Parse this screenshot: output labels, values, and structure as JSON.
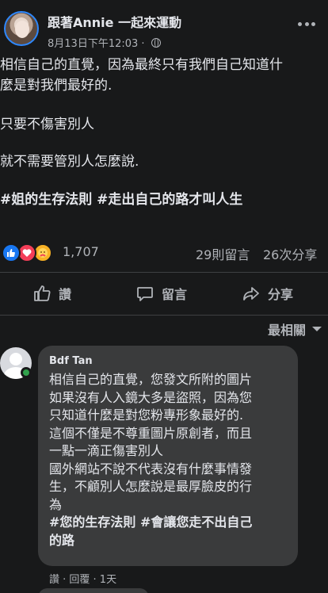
{
  "post": {
    "author": "跟著Annie 一起來運動",
    "timestamp": "8月13日下午12:03 ·",
    "privacy_icon": "globe-icon",
    "body": {
      "line1": "相信自己的直覺，因為最終只有我們自己知道什",
      "line2": "麼是對我們最好的.",
      "line3": "只要不傷害別人",
      "line4": "就不需要管別人怎麼說.",
      "hashtags": "#姐的生存法則 #走出自己的路才叫人生"
    }
  },
  "reactions": {
    "icons": [
      "like-icon",
      "love-icon",
      "care-icon"
    ],
    "count": "1,707",
    "comments": "29則留言",
    "shares": "26次分享"
  },
  "actions": {
    "like": "讚",
    "comment": "留言",
    "share": "分享"
  },
  "sort": {
    "label": "最相關"
  },
  "comment": {
    "name": "Bdf Tan",
    "lines": [
      "相信自己的直覺，您發文所附的圖片",
      "如果沒有人入鏡大多是盜照，因為您",
      "只知道什麼是對您粉專形象最好的.",
      "這個不僅是不尊重圖片原創者，而且",
      "一點一滴正傷害別人",
      "國外網站不說不代表沒有什麼事情發",
      "生，不顧別人怎麼說是最厚臉皮的行",
      "為"
    ],
    "hashtag_lines": [
      "#您的生存法則 #會讓您走不出自己",
      "的路"
    ],
    "actions": "讚 · 回覆 · 1天"
  },
  "colors": {
    "background": "#18191a",
    "bubble": "#3a3b3c",
    "text": "#e4e6eb",
    "secondary": "#b0b3b8",
    "accent": "#2d88ff",
    "online": "#31a24c"
  }
}
